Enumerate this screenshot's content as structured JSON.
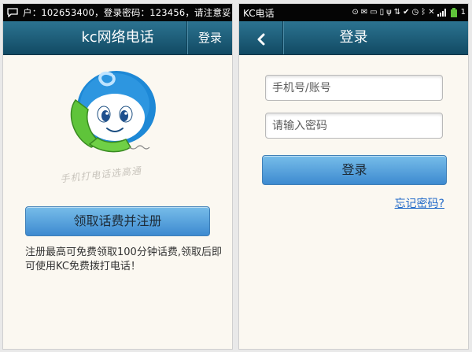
{
  "left": {
    "status_text": "户：102653400，登录密码：123456，请注意妥",
    "title": "kc网络电话",
    "login_label": "登录",
    "watermark_text": "手机打电话选高通",
    "claim_button": "领取话费并注册",
    "promo_text": "注册最高可免费领取100分钟话费,领取后即可使用KC免费拨打电话！"
  },
  "right": {
    "status_app": "KC电话",
    "status_time": "1",
    "title": "登录",
    "back_icon": "chevron-left-icon",
    "phone_placeholder": "手机号/账号",
    "password_placeholder": "请输入密码",
    "login_button": "登录",
    "forgot_link": "忘记密码?"
  },
  "colors": {
    "titlebar": "#1a5a76",
    "button": "#5aa3dd",
    "link": "#1f68c8",
    "background": "#fbf8f1",
    "mascot_blue": "#1d88d6",
    "mascot_green": "#5fc43a"
  }
}
